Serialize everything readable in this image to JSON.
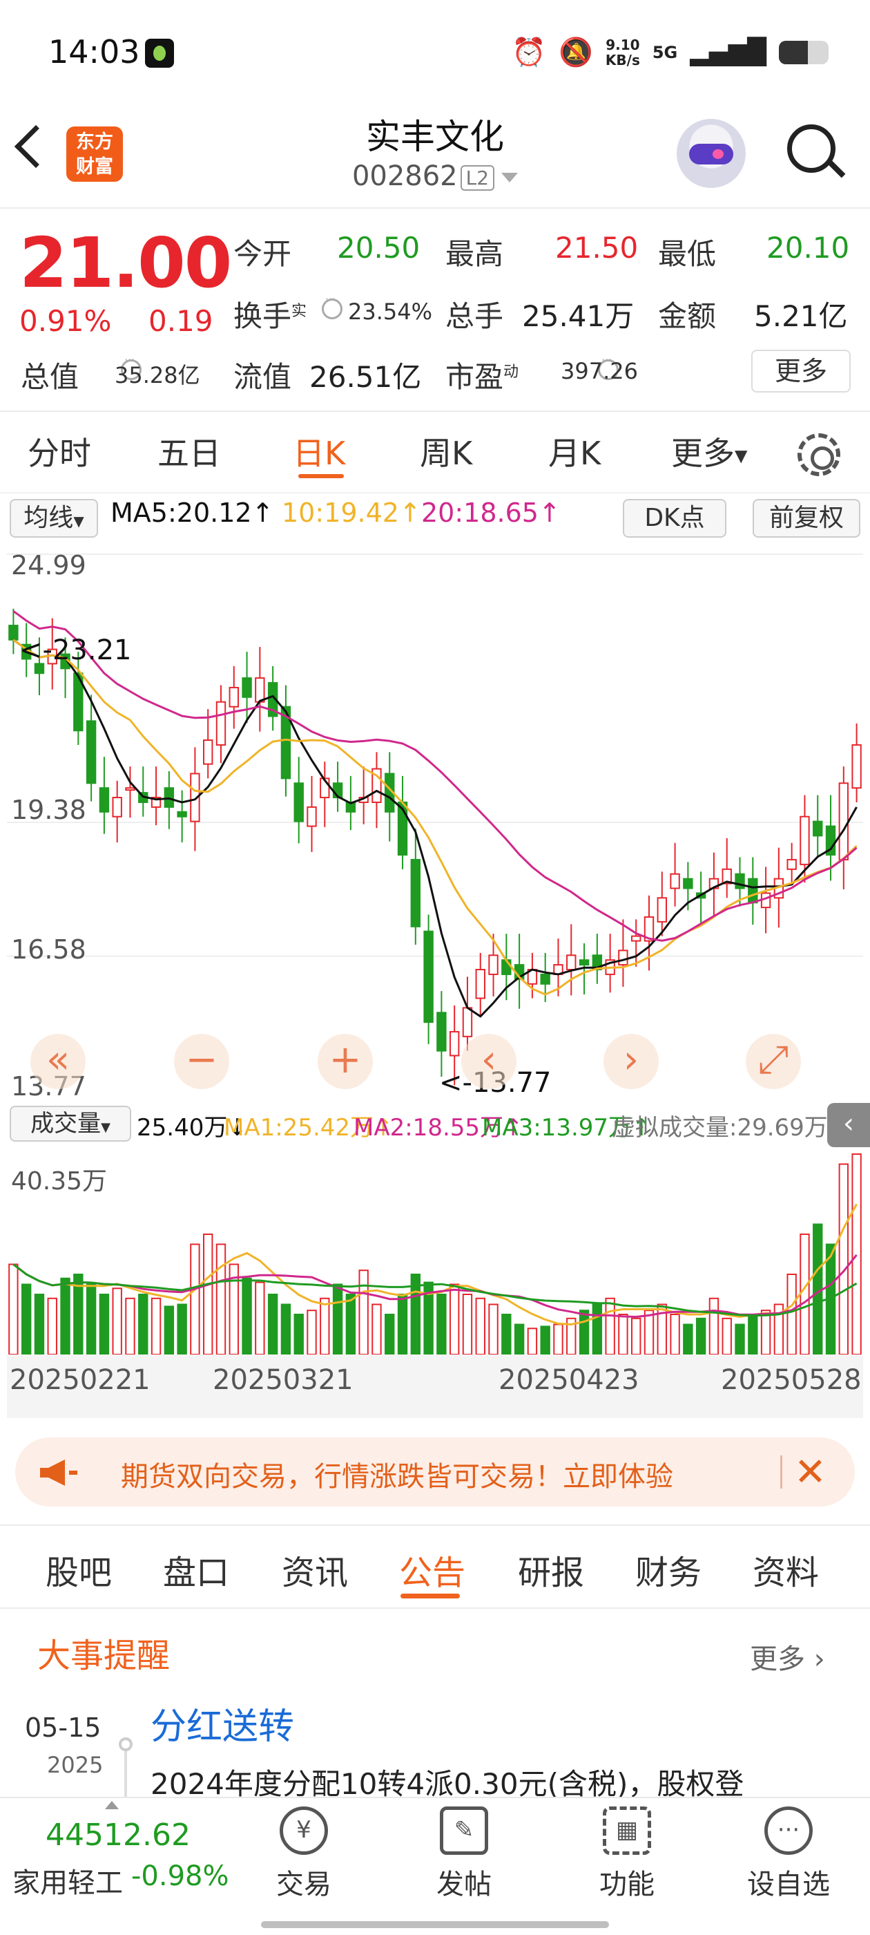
{
  "status_bar": {
    "time": "14:03",
    "net_speed": "9.10",
    "net_unit": "KB/s",
    "network": "5G"
  },
  "header": {
    "title": "实丰文化",
    "code": "002862",
    "badge": "L2"
  },
  "quote": {
    "price": "21.00",
    "change_pct": "0.91%",
    "change": "0.19",
    "open_label": "今开",
    "open": "20.50",
    "high_label": "最高",
    "high": "21.50",
    "low_label": "最低",
    "low": "20.10",
    "turnover_label": "换手",
    "turnover_sup": "实",
    "turnover": "23.54%",
    "volume_label": "总手",
    "volume": "25.41万",
    "amount_label": "金额",
    "amount": "5.21亿",
    "mktcap_label": "总值",
    "mktcap": "35.28亿",
    "float_label": "流值",
    "float": "26.51亿",
    "pe_label": "市盈",
    "pe_sup": "动",
    "pe": "397.26",
    "more": "更多"
  },
  "chart_tabs": [
    "分时",
    "五日",
    "日K",
    "周K",
    "月K",
    "更多"
  ],
  "indicators": {
    "ma_select": "均线",
    "ma5": "MA5:20.12",
    "ma10": "10:19.42",
    "ma20": "20:18.65",
    "dk": "DK点",
    "adjust": "前复权",
    "ma5_color": "#111111",
    "ma10_color": "#f0b429",
    "ma20_color": "#d0288c"
  },
  "chart_data": {
    "type": "candlestick",
    "y_ticks": [
      "24.99",
      "19.38",
      "16.58",
      "13.77"
    ],
    "ylim": [
      13.77,
      24.99
    ],
    "annotations": {
      "high_mark": "<-23.21",
      "low_mark": "<-13.77"
    },
    "x_ticks": [
      "20250221",
      "20250321",
      "20250423",
      "20250528"
    ],
    "volume": {
      "label": "成交量",
      "value": "25.40万",
      "ma1": "MA1:25.42万",
      "ma2": "MA2:18.55万",
      "ma3": "MA3:13.97万",
      "virtual": "虚拟成交量:29.69万",
      "max_tick": "40.35万"
    }
  },
  "banner": {
    "text": "期货双向交易，行情涨跌皆可交易！立即体验"
  },
  "bottom_tabs": [
    "股吧",
    "盘口",
    "资讯",
    "公告",
    "研报",
    "财务",
    "资料"
  ],
  "events": {
    "title": "大事提醒",
    "more": "更多",
    "items": [
      {
        "date": "05-15",
        "year": "2025",
        "title": "分红送转",
        "desc": "2024年度分配10转4派0.30元(含税)，股权登"
      }
    ]
  },
  "footer": {
    "index_value": "44512.62",
    "index_name": "家用轻工",
    "index_change": "-0.98%",
    "items": [
      "交易",
      "发帖",
      "功能",
      "设自选"
    ]
  }
}
